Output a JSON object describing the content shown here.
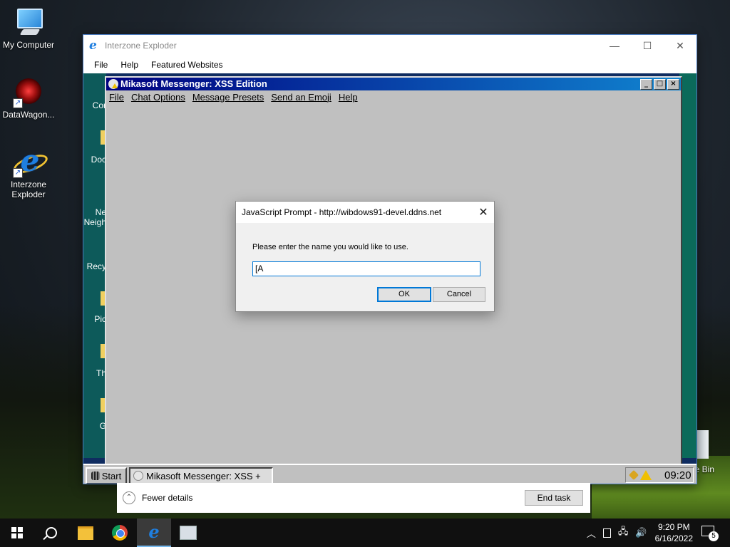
{
  "desktop": {
    "icons": [
      {
        "label": "My Computer"
      },
      {
        "label": "DataWagon..."
      },
      {
        "label": "Interzone Exploder"
      }
    ],
    "recycle_bin_label": "le Bin"
  },
  "browser": {
    "title": "Interzone Exploder",
    "menu": [
      "File",
      "Help",
      "Featured Websites"
    ],
    "controls": {
      "minimize": "—",
      "maximize": "☐",
      "close": "✕"
    }
  },
  "inner_desktop": {
    "icon_labels": [
      "Cor",
      "Doc",
      "Ne",
      "Neigh",
      "Recy",
      "Pic",
      "Th",
      "G"
    ]
  },
  "messenger": {
    "title": "Mikasoft Messenger: XSS Edition",
    "menu": [
      "File",
      "Chat Options",
      "Message Presets",
      "Send an Emoji",
      "Help"
    ],
    "controls": {
      "minimize": "_",
      "maximize": "□",
      "close": "×"
    }
  },
  "inner_taskbar": {
    "start_label": "Start",
    "task_label": "Mikasoft Messenger: XSS +",
    "time": "09:20"
  },
  "prompt": {
    "title": "JavaScript Prompt - http://wibdows91-devel.ddns.net",
    "close": "✕",
    "message": "Please enter the name you would like to use.",
    "input_value": "[A",
    "ok_label": "OK",
    "cancel_label": "Cancel"
  },
  "task_manager": {
    "fewer_details": "Fewer details",
    "end_task": "End task",
    "chevron": "⌃"
  },
  "taskbar": {
    "clock_time": "9:20 PM",
    "clock_date": "6/16/2022",
    "notification_count": "5",
    "tray_symbols": {
      "chevron": "︿",
      "network": "🖧",
      "volume": "🔊"
    }
  }
}
